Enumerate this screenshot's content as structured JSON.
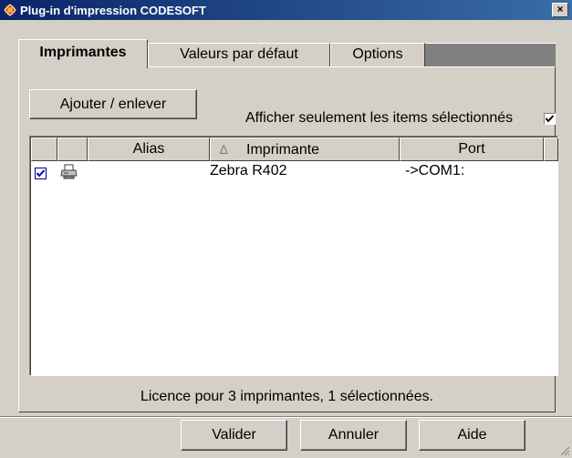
{
  "window": {
    "title": "Plug-in d'impression CODESOFT",
    "close_label": "×"
  },
  "tabs": [
    {
      "label": "Imprimantes"
    },
    {
      "label": "Valeurs par défaut"
    },
    {
      "label": "Options"
    }
  ],
  "toolbar": {
    "add_remove_label": "Ajouter / enlever",
    "show_selected_label": "Afficher seulement les items sélectionnés",
    "show_selected_checked": true
  },
  "table": {
    "columns": [
      "Alias",
      "Imprimante",
      "Port"
    ],
    "sort_indicator": "∆",
    "rows": [
      {
        "checked": true,
        "icon": "printer-icon",
        "alias": "",
        "printer": "Zebra R402",
        "port": "->COM1:"
      }
    ]
  },
  "status": "Licence pour 3 imprimantes, 1 sélectionnées.",
  "buttons": {
    "ok": "Valider",
    "cancel": "Annuler",
    "help": "Aide"
  },
  "colors": {
    "titlebar": "#0a246a",
    "face": "#d4d0c8",
    "check": "#0000cc"
  }
}
